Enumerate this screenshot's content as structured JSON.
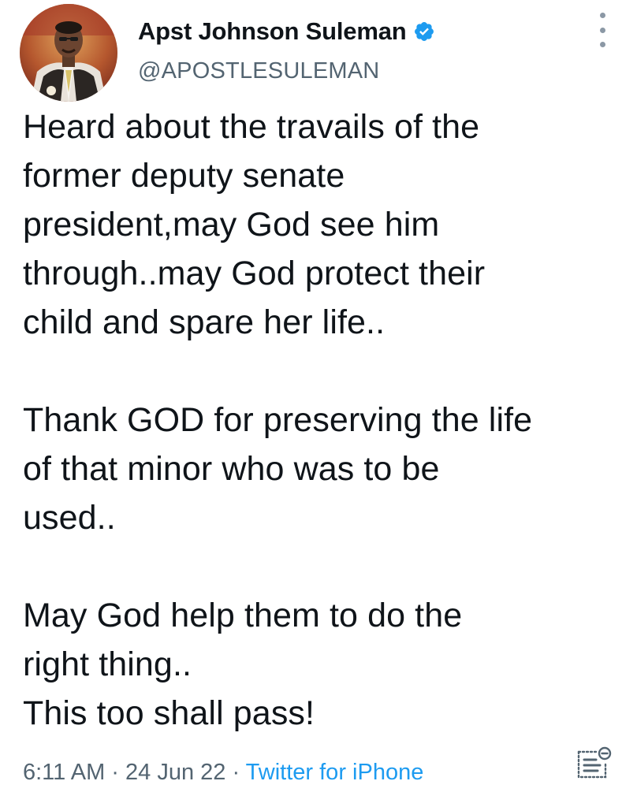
{
  "author": {
    "display_name": "Apst Johnson Suleman",
    "handle": "@APOSTLESULEMAN",
    "verified": true,
    "avatar": "profile-photo"
  },
  "tweet": {
    "paragraphs": [
      [
        "Heard about the travails of the",
        "former deputy senate",
        "president,may God see him",
        "through..may God protect their",
        "child and spare her life.."
      ],
      [
        "Thank GOD for preserving the life",
        "of that minor who was to be",
        "used.."
      ],
      [
        "May God help them to do the",
        "right thing..",
        "This too shall pass!"
      ]
    ]
  },
  "meta": {
    "time": "6:11 AM",
    "sep1": " · ",
    "date": "24 Jun 22",
    "sep2": " · ",
    "source": "Twitter for iPhone"
  },
  "icons": {
    "verified": "verified-badge-icon",
    "more": "more-options-icon",
    "analytics": "analytics-icon"
  },
  "colors": {
    "text": "#0f1419",
    "secondary": "#536471",
    "accent": "#1d9bf0"
  }
}
